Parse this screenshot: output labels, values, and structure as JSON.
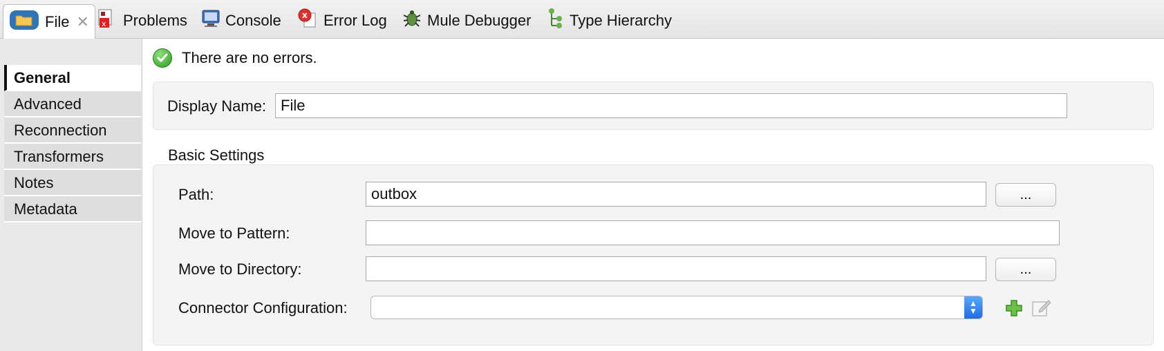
{
  "tabs": [
    {
      "label": "File",
      "icon": "folder-icon",
      "active": true
    },
    {
      "label": "Problems",
      "icon": "problems-icon"
    },
    {
      "label": "Console",
      "icon": "console-icon"
    },
    {
      "label": "Error Log",
      "icon": "error-log-icon"
    },
    {
      "label": "Mule Debugger",
      "icon": "bug-icon"
    },
    {
      "label": "Type Hierarchy",
      "icon": "hierarchy-icon"
    }
  ],
  "tab_close_glyph": "✕",
  "nav": {
    "items": [
      {
        "label": "General",
        "active": true
      },
      {
        "label": "Advanced"
      },
      {
        "label": "Reconnection"
      },
      {
        "label": "Transformers"
      },
      {
        "label": "Notes"
      },
      {
        "label": "Metadata"
      }
    ]
  },
  "status": {
    "message": "There are no errors.",
    "icon": "check-circle-icon"
  },
  "general": {
    "display_name_label": "Display Name:",
    "display_name_value": "File"
  },
  "basic": {
    "title": "Basic Settings",
    "path_label": "Path:",
    "path_value": "outbox",
    "move_pattern_label": "Move to Pattern:",
    "move_pattern_value": "",
    "move_dir_label": "Move to Directory:",
    "move_dir_value": "",
    "connector_label": "Connector Configuration:",
    "connector_value": "",
    "browse_label": "..."
  },
  "colors": {
    "accent": "#1c6fe5",
    "ok": "#2f9a22",
    "add": "#3ca12a"
  }
}
